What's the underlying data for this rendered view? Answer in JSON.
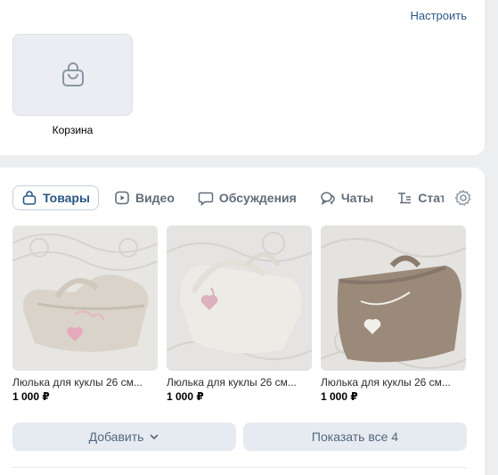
{
  "top_section": {
    "settings_label": "Настроить",
    "cart_label": "Корзина"
  },
  "tabs": [
    {
      "label": "Товары",
      "icon": "bag-icon",
      "active": true
    },
    {
      "label": "Видео",
      "icon": "video-icon",
      "active": false
    },
    {
      "label": "Обсуждения",
      "icon": "chat-bubble-icon",
      "active": false
    },
    {
      "label": "Чаты",
      "icon": "chats-icon",
      "active": false
    },
    {
      "label": "Статьи",
      "icon": "article-icon",
      "active": false
    }
  ],
  "products": [
    {
      "name": "Люлька для куклы 26 см...",
      "price": "1 000 ₽"
    },
    {
      "name": "Люлька для куклы 26 см...",
      "price": "1 000 ₽"
    },
    {
      "name": "Люлька для куклы 26 см...",
      "price": "1 000 ₽"
    }
  ],
  "buttons": {
    "add_label": "Добавить",
    "show_all_label": "Показать все 4"
  },
  "colors": {
    "link": "#2a5885",
    "background": "#edeef0",
    "button_bg": "#e5ebf1"
  }
}
